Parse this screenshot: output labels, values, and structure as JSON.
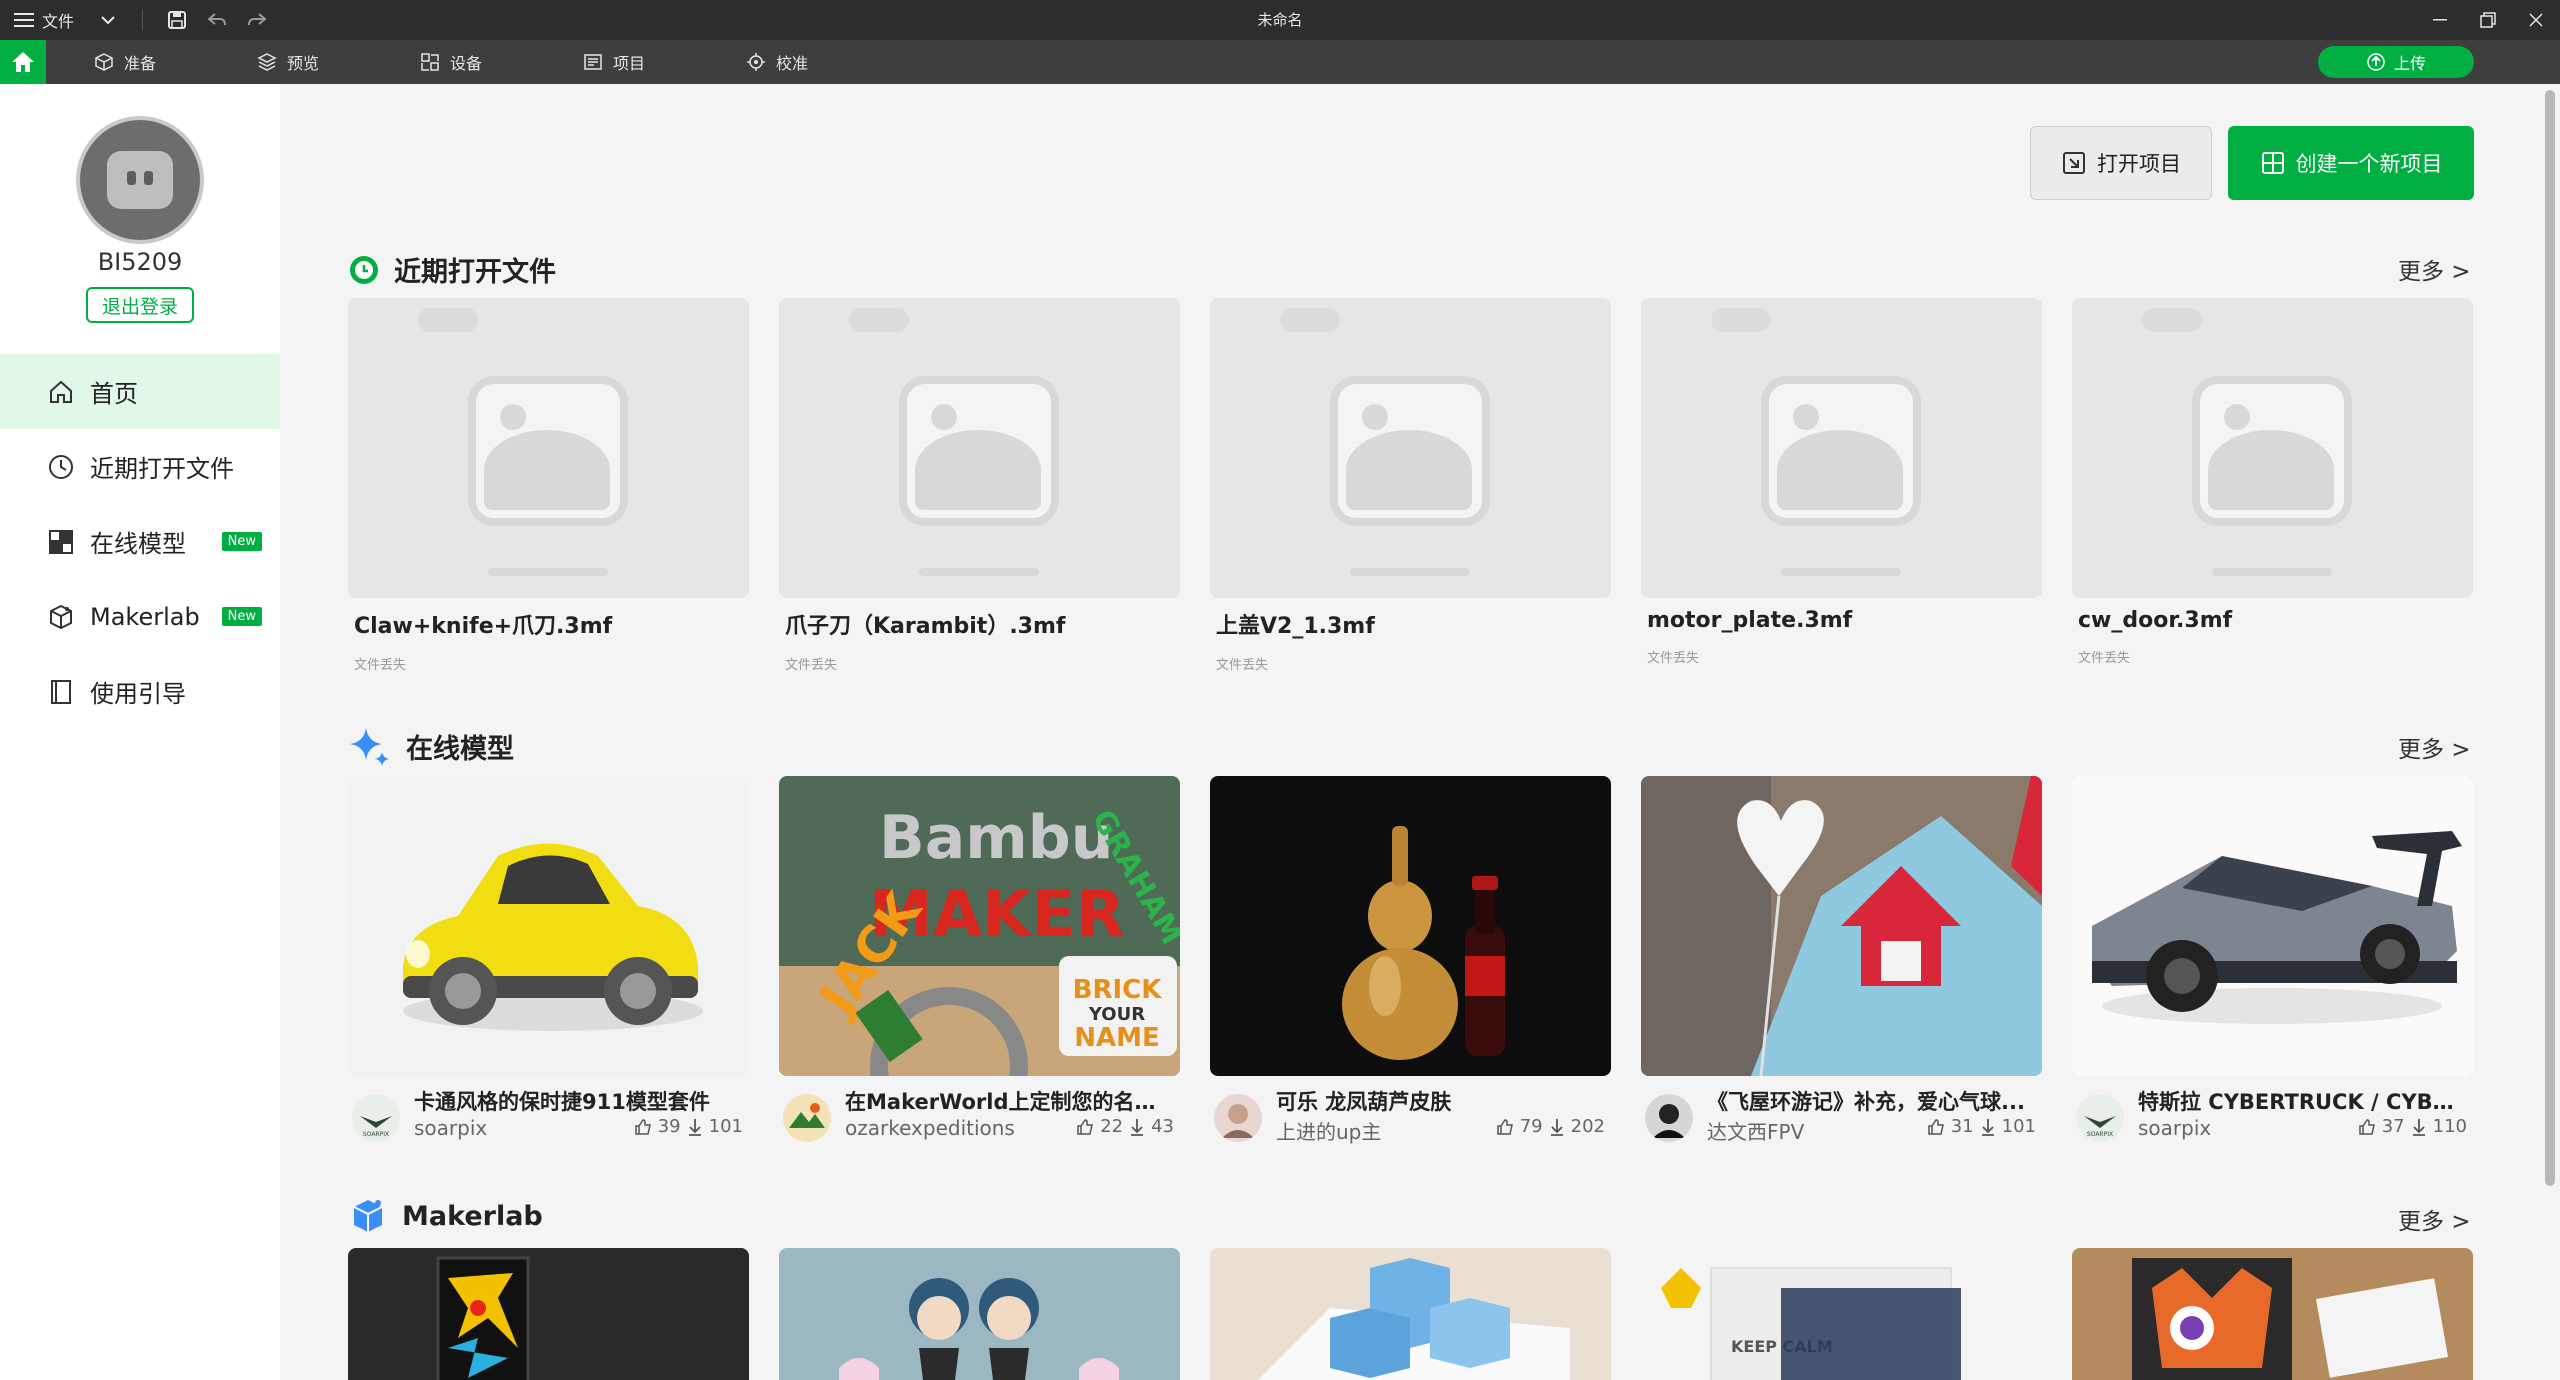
{
  "titlebar": {
    "file_label": "文件",
    "title": "未命名"
  },
  "navbar": {
    "tabs": [
      {
        "label": "准备",
        "icon": "cube-icon"
      },
      {
        "label": "预览",
        "icon": "layers-icon"
      },
      {
        "label": "设备",
        "icon": "device-icon"
      },
      {
        "label": "项目",
        "icon": "project-icon"
      },
      {
        "label": "校准",
        "icon": "calibrate-icon"
      }
    ],
    "upload_label": "上传"
  },
  "sidebar": {
    "username": "BI5209",
    "logout_label": "退出登录",
    "items": [
      {
        "label": "首页",
        "icon": "home-icon",
        "active": true,
        "badge": ""
      },
      {
        "label": "近期打开文件",
        "icon": "clock-icon",
        "active": false,
        "badge": ""
      },
      {
        "label": "在线模型",
        "icon": "cubes-icon",
        "active": false,
        "badge": "New"
      },
      {
        "label": "Makerlab",
        "icon": "makerlab-icon",
        "active": false,
        "badge": "New"
      },
      {
        "label": "使用引导",
        "icon": "book-icon",
        "active": false,
        "badge": ""
      }
    ]
  },
  "main": {
    "open_project_label": "打开项目",
    "create_project_label": "创建一个新项目",
    "recent": {
      "title": "近期打开文件",
      "more": "更多 >",
      "files": [
        {
          "name": "Claw+knife+爪刀.3mf",
          "status": "文件丢失"
        },
        {
          "name": "爪子刀（Karambit）.3mf",
          "status": "文件丢失"
        },
        {
          "name": "上盖V2_1.3mf",
          "status": "文件丢失"
        },
        {
          "name": "motor_plate.3mf",
          "status": "文件丢失"
        },
        {
          "name": "cw_door.3mf",
          "status": "文件丢失"
        }
      ]
    },
    "online": {
      "title": "在线模型",
      "more": "更多 >",
      "models": [
        {
          "title": "卡通风格的保时捷911模型套件",
          "author": "soarpix",
          "likes": "39",
          "downloads": "101"
        },
        {
          "title": "在MakerWorld上定制您的名字...",
          "author": "ozarkexpeditions",
          "likes": "22",
          "downloads": "43"
        },
        {
          "title": "可乐 龙凤葫芦皮肤",
          "author": "上进的up主",
          "likes": "79",
          "downloads": "202"
        },
        {
          "title": "《飞屋环游记》补充，爱心气球...",
          "author": "达文西FPV",
          "likes": "31",
          "downloads": "101"
        },
        {
          "title": "特斯拉 CYBERTRUCK / CYBER...",
          "author": "soarpix",
          "likes": "37",
          "downloads": "110"
        }
      ]
    },
    "makerlab": {
      "title": "Makerlab",
      "more": "更多 >",
      "keep_calm_text": "KEEP CALM"
    },
    "thumb_texts": {
      "bambu": "Bambu",
      "maker": "MAKER",
      "jack": "JACK",
      "brick": "BRICK",
      "your": "YOUR",
      "name": "NAME",
      "graham": "GRAHAM"
    }
  }
}
